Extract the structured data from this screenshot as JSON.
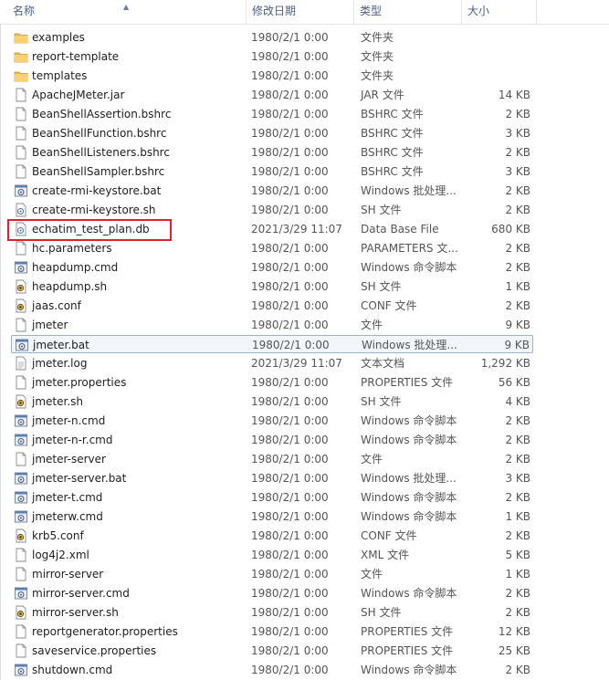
{
  "columns": {
    "name": "名称",
    "date": "修改日期",
    "type": "类型",
    "size": "大小"
  },
  "colors": {
    "header_text": "#4d6082",
    "highlight": "#e0202a",
    "selection_border": "#99b4d1"
  },
  "rows": [
    {
      "name": "examples",
      "date": "1980/2/1 0:00",
      "type": "文件夹",
      "size": "",
      "icon": "folder-icon"
    },
    {
      "name": "report-template",
      "date": "1980/2/1 0:00",
      "type": "文件夹",
      "size": "",
      "icon": "folder-icon"
    },
    {
      "name": "templates",
      "date": "1980/2/1 0:00",
      "type": "文件夹",
      "size": "",
      "icon": "folder-icon"
    },
    {
      "name": "ApacheJMeter.jar",
      "date": "1980/2/1 0:00",
      "type": "JAR 文件",
      "size": "14 KB",
      "icon": "file-icon"
    },
    {
      "name": "BeanShellAssertion.bshrc",
      "date": "1980/2/1 0:00",
      "type": "BSHRC 文件",
      "size": "2 KB",
      "icon": "file-icon"
    },
    {
      "name": "BeanShellFunction.bshrc",
      "date": "1980/2/1 0:00",
      "type": "BSHRC 文件",
      "size": "3 KB",
      "icon": "file-icon"
    },
    {
      "name": "BeanShellListeners.bshrc",
      "date": "1980/2/1 0:00",
      "type": "BSHRC 文件",
      "size": "2 KB",
      "icon": "file-icon"
    },
    {
      "name": "BeanShellSampler.bshrc",
      "date": "1980/2/1 0:00",
      "type": "BSHRC 文件",
      "size": "3 KB",
      "icon": "file-icon"
    },
    {
      "name": "create-rmi-keystore.bat",
      "date": "1980/2/1 0:00",
      "type": "Windows 批处理...",
      "size": "2 KB",
      "icon": "batch-file-icon"
    },
    {
      "name": "create-rmi-keystore.sh",
      "date": "1980/2/1 0:00",
      "type": "SH 文件",
      "size": "2 KB",
      "icon": "script-file-icon"
    },
    {
      "name": "echatim_test_plan.db",
      "date": "2021/3/29 11:07",
      "type": "Data Base File",
      "size": "680 KB",
      "icon": "script-file-icon"
    },
    {
      "name": "hc.parameters",
      "date": "1980/2/1 0:00",
      "type": "PARAMETERS 文...",
      "size": "2 KB",
      "icon": "file-icon"
    },
    {
      "name": "heapdump.cmd",
      "date": "1980/2/1 0:00",
      "type": "Windows 命令脚本",
      "size": "2 KB",
      "icon": "batch-file-icon"
    },
    {
      "name": "heapdump.sh",
      "date": "1980/2/1 0:00",
      "type": "SH 文件",
      "size": "1 KB",
      "icon": "sh-file-icon"
    },
    {
      "name": "jaas.conf",
      "date": "1980/2/1 0:00",
      "type": "CONF 文件",
      "size": "2 KB",
      "icon": "sh-file-icon"
    },
    {
      "name": "jmeter",
      "date": "1980/2/1 0:00",
      "type": "文件",
      "size": "9 KB",
      "icon": "file-icon"
    },
    {
      "name": "jmeter.bat",
      "date": "1980/2/1 0:00",
      "type": "Windows 批处理...",
      "size": "9 KB",
      "icon": "batch-file-icon",
      "selected": true
    },
    {
      "name": "jmeter.log",
      "date": "2021/3/29 11:07",
      "type": "文本文档",
      "size": "1,292 KB",
      "icon": "text-file-icon"
    },
    {
      "name": "jmeter.properties",
      "date": "1980/2/1 0:00",
      "type": "PROPERTIES 文件",
      "size": "56 KB",
      "icon": "file-icon"
    },
    {
      "name": "jmeter.sh",
      "date": "1980/2/1 0:00",
      "type": "SH 文件",
      "size": "4 KB",
      "icon": "sh-file-icon"
    },
    {
      "name": "jmeter-n.cmd",
      "date": "1980/2/1 0:00",
      "type": "Windows 命令脚本",
      "size": "2 KB",
      "icon": "batch-file-icon"
    },
    {
      "name": "jmeter-n-r.cmd",
      "date": "1980/2/1 0:00",
      "type": "Windows 命令脚本",
      "size": "2 KB",
      "icon": "batch-file-icon"
    },
    {
      "name": "jmeter-server",
      "date": "1980/2/1 0:00",
      "type": "文件",
      "size": "2 KB",
      "icon": "file-icon"
    },
    {
      "name": "jmeter-server.bat",
      "date": "1980/2/1 0:00",
      "type": "Windows 批处理...",
      "size": "3 KB",
      "icon": "batch-file-icon"
    },
    {
      "name": "jmeter-t.cmd",
      "date": "1980/2/1 0:00",
      "type": "Windows 命令脚本",
      "size": "2 KB",
      "icon": "batch-file-icon"
    },
    {
      "name": "jmeterw.cmd",
      "date": "1980/2/1 0:00",
      "type": "Windows 命令脚本",
      "size": "1 KB",
      "icon": "batch-file-icon"
    },
    {
      "name": "krb5.conf",
      "date": "1980/2/1 0:00",
      "type": "CONF 文件",
      "size": "2 KB",
      "icon": "sh-file-icon"
    },
    {
      "name": "log4j2.xml",
      "date": "1980/2/1 0:00",
      "type": "XML 文件",
      "size": "5 KB",
      "icon": "file-icon"
    },
    {
      "name": "mirror-server",
      "date": "1980/2/1 0:00",
      "type": "文件",
      "size": "1 KB",
      "icon": "file-icon"
    },
    {
      "name": "mirror-server.cmd",
      "date": "1980/2/1 0:00",
      "type": "Windows 命令脚本",
      "size": "2 KB",
      "icon": "batch-file-icon"
    },
    {
      "name": "mirror-server.sh",
      "date": "1980/2/1 0:00",
      "type": "SH 文件",
      "size": "2 KB",
      "icon": "sh-file-icon"
    },
    {
      "name": "reportgenerator.properties",
      "date": "1980/2/1 0:00",
      "type": "PROPERTIES 文件",
      "size": "12 KB",
      "icon": "file-icon"
    },
    {
      "name": "saveservice.properties",
      "date": "1980/2/1 0:00",
      "type": "PROPERTIES 文件",
      "size": "25 KB",
      "icon": "file-icon"
    },
    {
      "name": "shutdown.cmd",
      "date": "1980/2/1 0:00",
      "type": "Windows 命令脚本",
      "size": "2 KB",
      "icon": "batch-file-icon"
    }
  ]
}
